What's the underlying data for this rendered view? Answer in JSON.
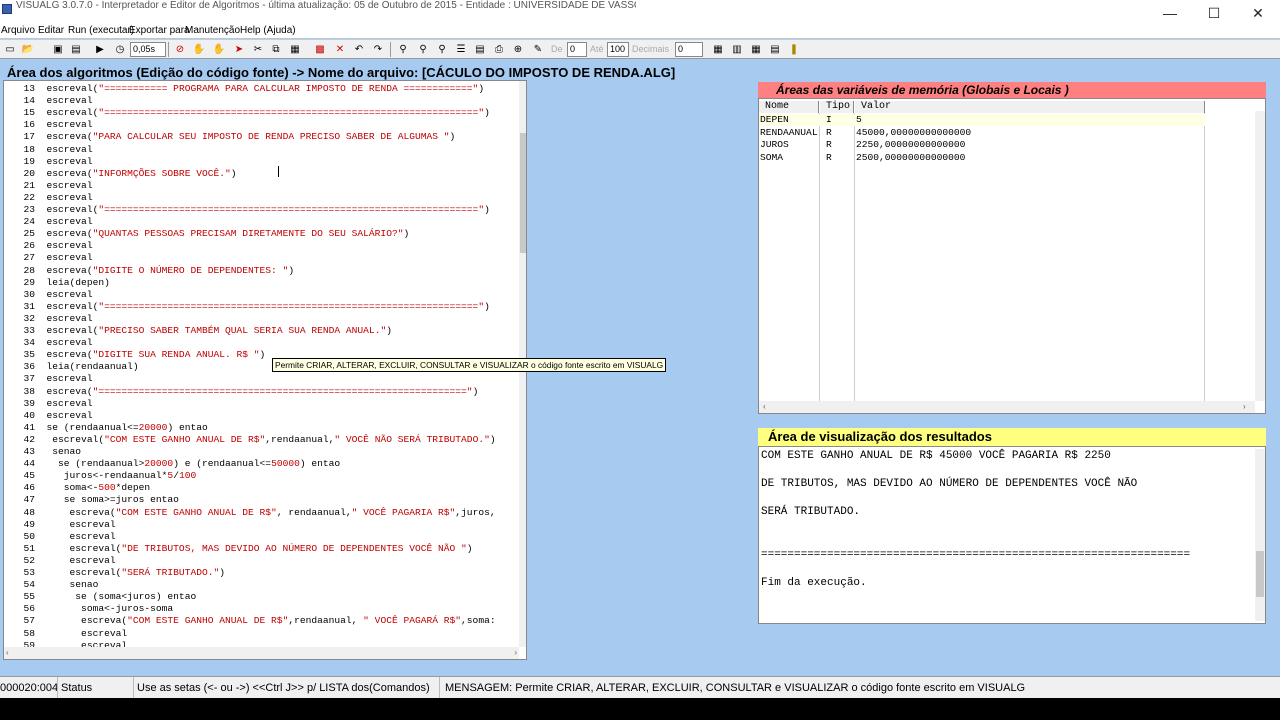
{
  "window": {
    "title": "VISUALG 3.0.7.0 - Interpretador e Editor de Algoritmos - última atualização: 05 de Outubro de 2015 - Entidade : UNIVERSIDADE DE VASSOURAS CAMPUS MARICÁ",
    "minimize": "—",
    "maximize": "☐",
    "close": "✕"
  },
  "menu": [
    "Arquivo",
    "Editar",
    "Run (executar)",
    "Exportar para",
    "Manutenção",
    "Help (Ajuda)"
  ],
  "toolbar": {
    "speed": "0,05s",
    "de_label": "De",
    "de_value": "0",
    "ate_label": "Até",
    "ate_value": "100",
    "decimais_label": "Decimais",
    "decimais_value": "0"
  },
  "code_panel": {
    "title": "Área dos algoritmos (Edição do código fonte) -> Nome do arquivo: [CÁCULO DO IMPOSTO DE RENDA.ALG]",
    "tooltip": "Permite CRIAR, ALTERAR, EXCLUIR, CONSULTAR e VISUALIZAR o código fonte escrito em VISUALG",
    "lines": [
      {
        "n": "13",
        "code": "escreval(\"=========== PROGRAMA PARA CALCULAR IMPOSTO DE RENDA ============\")"
      },
      {
        "n": "14",
        "code": "escreval"
      },
      {
        "n": "15",
        "code": "escreval(\"=================================================================\")"
      },
      {
        "n": "16",
        "code": "escreval"
      },
      {
        "n": "17",
        "code": "escreva(\"PARA CALCULAR SEU IMPOSTO DE RENDA PRECISO SABER DE ALGUMAS \")"
      },
      {
        "n": "18",
        "code": "escreval"
      },
      {
        "n": "19",
        "code": "escreval"
      },
      {
        "n": "20",
        "code": "escreva(\"INFORMÇÕES SOBRE VOCÊ.\")"
      },
      {
        "n": "21",
        "code": "escreval"
      },
      {
        "n": "22",
        "code": "escreval"
      },
      {
        "n": "23",
        "code": "escreval(\"=================================================================\")"
      },
      {
        "n": "24",
        "code": "escreval"
      },
      {
        "n": "25",
        "code": "escreva(\"QUANTAS PESSOAS PRECISAM DIRETAMENTE DO SEU SALÁRIO?\")"
      },
      {
        "n": "26",
        "code": "escreval"
      },
      {
        "n": "27",
        "code": "escreval"
      },
      {
        "n": "28",
        "code": "escreva(\"DIGITE O NÚMERO DE DEPENDENTES: \")"
      },
      {
        "n": "29",
        "code": "leia(depen)"
      },
      {
        "n": "30",
        "code": "escreval"
      },
      {
        "n": "31",
        "code": "escreval(\"=================================================================\")"
      },
      {
        "n": "32",
        "code": "escreval"
      },
      {
        "n": "33",
        "code": "escreval(\"PRECISO SABER TAMBÉM QUAL SERIA SUA RENDA ANUAL.\")"
      },
      {
        "n": "34",
        "code": "escreval"
      },
      {
        "n": "35",
        "code": "escreva(\"DIGITE SUA RENDA ANUAL. R$ \")"
      },
      {
        "n": "36",
        "code": "leia(rendaanual)"
      },
      {
        "n": "37",
        "code": "escreval"
      },
      {
        "n": "38",
        "code": "escreva(\"================================================================\")"
      },
      {
        "n": "39",
        "code": "escreval"
      },
      {
        "n": "40",
        "code": "escreval"
      },
      {
        "n": "41",
        "code": "se (rendaanual<=20000) entao"
      },
      {
        "n": "42",
        "code": " escreval(\"COM ESTE GANHO ANUAL DE R$\",rendaanual,\" VOCÊ NÃO SERÁ TRIBUTADO.\")"
      },
      {
        "n": "43",
        "code": " senao"
      },
      {
        "n": "44",
        "code": "  se (rendaanual>20000) e (rendaanual<=50000) entao"
      },
      {
        "n": "45",
        "code": "   juros<-rendaanual*5/100"
      },
      {
        "n": "46",
        "code": "   soma<-500*depen"
      },
      {
        "n": "47",
        "code": "   se soma>=juros entao"
      },
      {
        "n": "48",
        "code": "    escreva(\"COM ESTE GANHO ANUAL DE R$\", rendaanual,\" VOCÊ PAGARIA R$\",juros,"
      },
      {
        "n": "49",
        "code": "    escreval"
      },
      {
        "n": "50",
        "code": "    escreval"
      },
      {
        "n": "51",
        "code": "    escreval(\"DE TRIBUTOS, MAS DEVIDO AO NÚMERO DE DEPENDENTES VOCÊ NÃO \")"
      },
      {
        "n": "52",
        "code": "    escreval"
      },
      {
        "n": "53",
        "code": "    escreval(\"SERÁ TRIBUTADO.\")"
      },
      {
        "n": "54",
        "code": "    senao"
      },
      {
        "n": "55",
        "code": "     se (soma<juros) entao"
      },
      {
        "n": "56",
        "code": "      soma<-juros-soma"
      },
      {
        "n": "57",
        "code": "      escreva(\"COM ESTE GANHO ANUAL DE R$\",rendaanual, \" VOCÊ PAGARÁ R$\",soma:"
      },
      {
        "n": "58",
        "code": "      escreval"
      },
      {
        "n": "59",
        "code": "      escreval"
      }
    ]
  },
  "variables_panel": {
    "title": "Áreas das variáveis de memória (Globais e Locais )",
    "headers": [
      "Nome",
      "Tipo",
      "Valor"
    ],
    "rows": [
      {
        "nome": "DEPEN",
        "tipo": "I",
        "valor": "5"
      },
      {
        "nome": "RENDAANUAL",
        "tipo": "R",
        "valor": "45000,00000000000000"
      },
      {
        "nome": "JUROS",
        "tipo": "R",
        "valor": "2250,00000000000000"
      },
      {
        "nome": "SOMA",
        "tipo": "R",
        "valor": "2500,00000000000000"
      }
    ]
  },
  "results_panel": {
    "title": "Área de visualização dos resultados",
    "lines": [
      "COM ESTE GANHO ANUAL DE R$ 45000 VOCÊ PAGARIA R$ 2250",
      "",
      "DE TRIBUTOS, MAS DEVIDO AO NÚMERO DE DEPENDENTES VOCÊ NÃO",
      "",
      "SERÁ TRIBUTADO.",
      "",
      "",
      "=================================================================",
      "",
      "Fim da execução."
    ]
  },
  "statusbar": {
    "position": "000020:004",
    "status": "Status",
    "hint": "Use as setas (<- ou ->) <<Ctrl J>> p/ LISTA dos(Comandos)",
    "message": "MENSAGEM: Permite CRIAR, ALTERAR, EXCLUIR, CONSULTAR e VISUALIZAR o código fonte escrito em VISUALG"
  }
}
